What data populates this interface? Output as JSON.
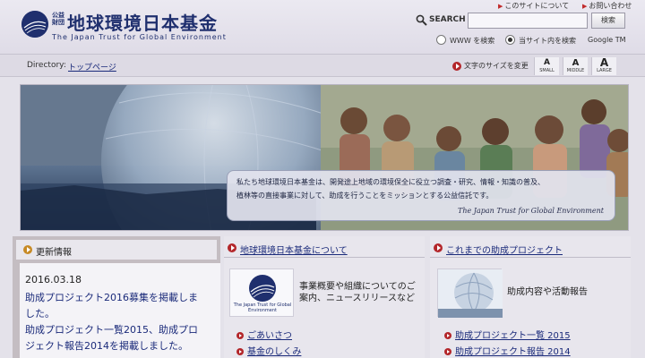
{
  "header": {
    "logo_prefix": "公益財団",
    "logo_title": "地球環境日本基金",
    "logo_subtitle": "The Japan Trust for Global Environment",
    "top_links": [
      "このサイトについて",
      "お問い合わせ"
    ],
    "search": {
      "label": "SEARCH",
      "placeholder": "",
      "button_label": "検索",
      "options": [
        "WWW を検索",
        "当サイト内を検索"
      ],
      "selected_option": "当サイト内を検索",
      "provider": "Google TM"
    }
  },
  "navbar": {
    "directory_label": "Directory:",
    "breadcrumb": "トップページ",
    "font_size_label": "文字のサイズを変更",
    "font_sizes": [
      {
        "glyph": "A",
        "label": "SMALL"
      },
      {
        "glyph": "A",
        "label": "MIDDLE"
      },
      {
        "glyph": "A",
        "label": "LARGE"
      }
    ]
  },
  "hero": {
    "caption_line1": "私たち地球環境日本基金は、開発途上地域の環境保全に役立つ調査・研究、情報・知識の普及、",
    "caption_line2": "植林等の直接事業に対して、助成を行うことをミッションとする公益信託です。",
    "signature": "The Japan Trust for Global Environment"
  },
  "news": {
    "title": "更新情報",
    "date": "2016.03.18",
    "lines": [
      "助成プロジェクト2016募集を掲載しま",
      "した。",
      "助成プロジェクト一覧2015、助成プロ",
      "ジェクト報告2014を掲載しました。"
    ]
  },
  "about": {
    "title": "地球環境日本基金について",
    "thumb_caption": "The Japan Trust for Global Environment",
    "description": [
      "事業概要や組織についてのご",
      "案内、ニュースリリースなど"
    ],
    "links": [
      "ごあいさつ",
      "基金のしくみ"
    ]
  },
  "projects": {
    "title": "これまでの助成プロジェクト",
    "description": "助成内容や活動報告",
    "links": [
      "助成プロジェクト一覧 2015",
      "助成プロジェクト報告 2014"
    ]
  }
}
